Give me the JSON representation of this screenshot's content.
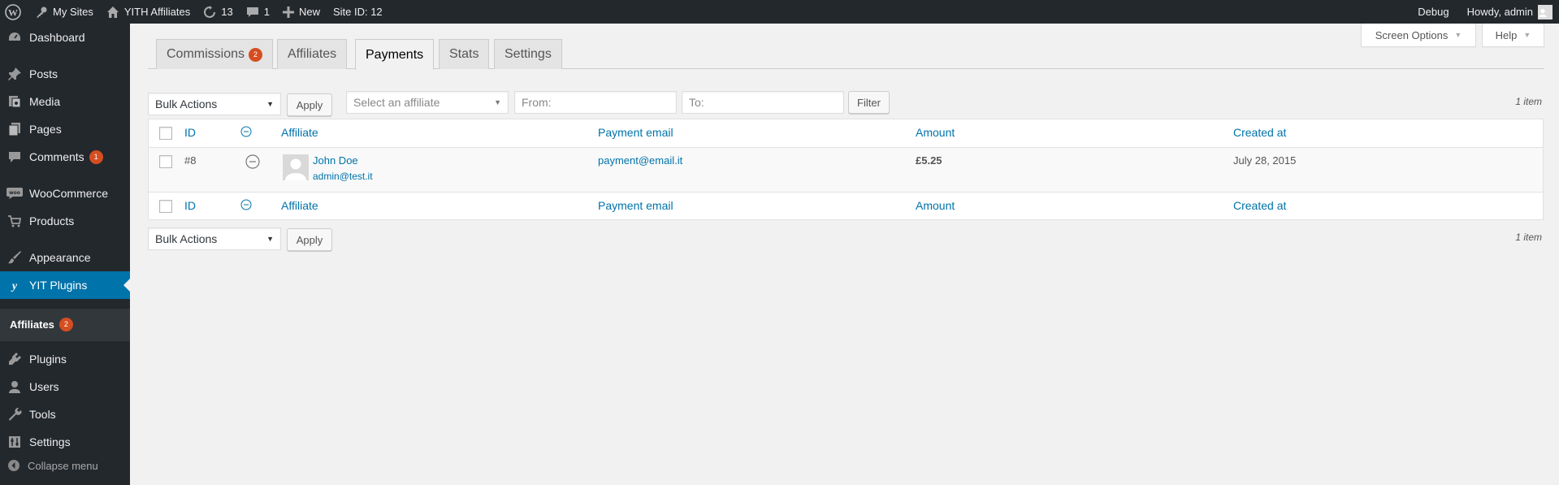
{
  "admin_bar": {
    "my_sites": "My Sites",
    "site_name": "YITH Affiliates",
    "updates_count": "13",
    "comments_count": "1",
    "new_label": "New",
    "site_id": "Site ID: 12",
    "debug": "Debug",
    "howdy": "Howdy, admin"
  },
  "sidebar": {
    "items": [
      {
        "label": "Dashboard",
        "icon": "dashboard-icon"
      },
      {
        "label": "Posts",
        "icon": "pin-icon"
      },
      {
        "label": "Media",
        "icon": "media-icon"
      },
      {
        "label": "Pages",
        "icon": "pages-icon"
      },
      {
        "label": "Comments",
        "icon": "comment-icon",
        "badge": "1"
      },
      {
        "label": "WooCommerce",
        "icon": "woocommerce-icon"
      },
      {
        "label": "Products",
        "icon": "cart-icon"
      },
      {
        "label": "Appearance",
        "icon": "brush-icon"
      },
      {
        "label": "YIT Plugins",
        "icon": "yit-icon"
      },
      {
        "label": "Plugins",
        "icon": "plug-icon"
      },
      {
        "label": "Users",
        "icon": "user-icon"
      },
      {
        "label": "Tools",
        "icon": "wrench-icon"
      },
      {
        "label": "Settings",
        "icon": "settings-icon"
      }
    ],
    "submenu": {
      "label": "Affiliates",
      "badge": "2"
    },
    "collapse": "Collapse menu"
  },
  "screen_meta": {
    "screen_options": "Screen Options",
    "help": "Help"
  },
  "tabs": [
    {
      "label": "Commissions",
      "badge": "2"
    },
    {
      "label": "Affiliates"
    },
    {
      "label": "Payments",
      "active": true
    },
    {
      "label": "Stats"
    },
    {
      "label": "Settings"
    }
  ],
  "filters": {
    "bulk_actions": "Bulk Actions",
    "apply": "Apply",
    "affiliate_placeholder": "Select an affiliate",
    "from_placeholder": "From:",
    "to_placeholder": "To:",
    "filter": "Filter",
    "items_count": "1 item"
  },
  "table": {
    "columns": [
      "ID",
      "Affiliate",
      "Payment email",
      "Amount",
      "Created at"
    ],
    "rows": [
      {
        "id": "#8",
        "affiliate_name": "John Doe",
        "affiliate_email": "admin@test.it",
        "payment_email": "payment@email.it",
        "amount": "£5.25",
        "created_at": "July 28, 2015"
      }
    ]
  },
  "colors": {
    "admin_bar": "#23282d",
    "accent": "#0073aa",
    "badge": "#d54e21",
    "background": "#f1f1f1"
  }
}
